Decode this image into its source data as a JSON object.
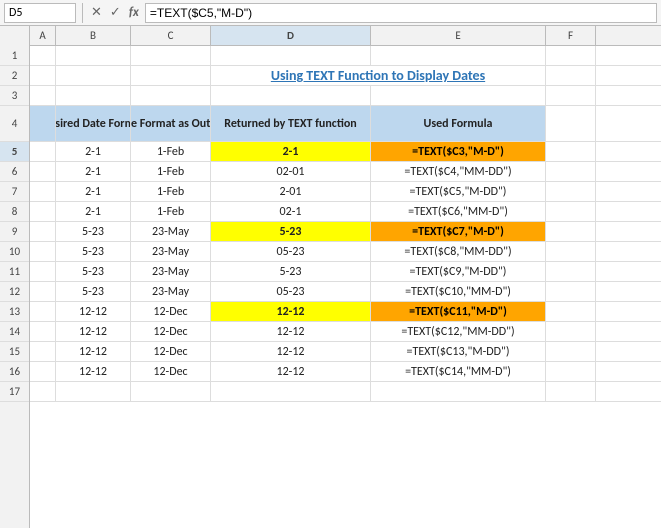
{
  "formulaBar": {
    "cellRef": "D5",
    "formula": "=TEXT($C5,\"M-D\")"
  },
  "title": "Using TEXT Function to Display Dates",
  "columns": {
    "A": {
      "label": "A",
      "class": "w-a"
    },
    "B": {
      "label": "B",
      "class": "w-b"
    },
    "C": {
      "label": "C",
      "class": "w-c"
    },
    "D": {
      "label": "D",
      "class": "w-d",
      "selected": true
    },
    "E": {
      "label": "E",
      "class": "w-e"
    },
    "F": {
      "label": "F",
      "class": "w-f"
    }
  },
  "headers": {
    "desiredDate": "Desired Date Format",
    "dateFormat": "Date Format as Output",
    "returned": "Returned by TEXT function",
    "usedFormula": "Used Formula"
  },
  "rows": [
    {
      "id": 1,
      "rowNum": "1",
      "a": "",
      "b": "",
      "c": "",
      "d": "",
      "e": "",
      "dClass": "",
      "eClass": ""
    },
    {
      "id": 2,
      "rowNum": "2",
      "a": "",
      "b": "",
      "c": "",
      "d": "Using TEXT Function to Display Dates",
      "e": "",
      "dClass": "title-cell",
      "eClass": "",
      "colspan": true
    },
    {
      "id": 3,
      "rowNum": "3",
      "a": "",
      "b": "",
      "c": "",
      "d": "",
      "e": "",
      "dClass": "",
      "eClass": ""
    },
    {
      "id": 4,
      "rowNum": "4",
      "a": "",
      "b": "Desired Date Format",
      "c": "Date Format as Output",
      "d": "Returned by TEXT function",
      "e": "Used Formula",
      "dClass": "header-bg",
      "eClass": "header-bg",
      "bClass": "header-bg",
      "cClass": "header-bg",
      "isHeader": true
    },
    {
      "id": 5,
      "rowNum": "5",
      "a": "",
      "b": "2-1",
      "c": "1-Feb",
      "d": "2-1",
      "e": "=TEXT($C3,\"M-D\")",
      "dClass": "yellow-bg",
      "eClass": "orange-bg"
    },
    {
      "id": 6,
      "rowNum": "6",
      "a": "",
      "b": "2-1",
      "c": "1-Feb",
      "d": "02-01",
      "e": "=TEXT($C4,\"MM-DD\")",
      "dClass": "",
      "eClass": ""
    },
    {
      "id": 7,
      "rowNum": "7",
      "a": "",
      "b": "2-1",
      "c": "1-Feb",
      "d": "2-01",
      "e": "=TEXT($C5,\"M-DD\")",
      "dClass": "",
      "eClass": ""
    },
    {
      "id": 8,
      "rowNum": "8",
      "a": "",
      "b": "2-1",
      "c": "1-Feb",
      "d": "02-1",
      "e": "=TEXT($C6,\"MM-D\")",
      "dClass": "",
      "eClass": ""
    },
    {
      "id": 9,
      "rowNum": "9",
      "a": "",
      "b": "5-23",
      "c": "23-May",
      "d": "5-23",
      "e": "=TEXT($C7,\"M-D\")",
      "dClass": "yellow-bg",
      "eClass": "orange-bg"
    },
    {
      "id": 10,
      "rowNum": "10",
      "a": "",
      "b": "5-23",
      "c": "23-May",
      "d": "05-23",
      "e": "=TEXT($C8,\"MM-DD\")",
      "dClass": "",
      "eClass": ""
    },
    {
      "id": 11,
      "rowNum": "11",
      "a": "",
      "b": "5-23",
      "c": "23-May",
      "d": "5-23",
      "e": "=TEXT($C9,\"M-DD\")",
      "dClass": "",
      "eClass": ""
    },
    {
      "id": 12,
      "rowNum": "12",
      "a": "",
      "b": "5-23",
      "c": "23-May",
      "d": "05-23",
      "e": "=TEXT($C10,\"MM-D\")",
      "dClass": "",
      "eClass": ""
    },
    {
      "id": 13,
      "rowNum": "13",
      "a": "",
      "b": "12-12",
      "c": "12-Dec",
      "d": "12-12",
      "e": "=TEXT($C11,\"M-D\")",
      "dClass": "yellow-bg",
      "eClass": "orange-bg"
    },
    {
      "id": 14,
      "rowNum": "14",
      "a": "",
      "b": "12-12",
      "c": "12-Dec",
      "d": "12-12",
      "e": "=TEXT($C12,\"MM-DD\")",
      "dClass": "",
      "eClass": ""
    },
    {
      "id": 15,
      "rowNum": "15",
      "a": "",
      "b": "12-12",
      "c": "12-Dec",
      "d": "12-12",
      "e": "=TEXT($C13,\"M-DD\")",
      "dClass": "",
      "eClass": ""
    },
    {
      "id": 16,
      "rowNum": "16",
      "a": "",
      "b": "12-12",
      "c": "12-Dec",
      "d": "12-12",
      "e": "=TEXT($C14,\"MM-D\")",
      "dClass": "",
      "eClass": ""
    },
    {
      "id": 17,
      "rowNum": "17",
      "a": "",
      "b": "",
      "c": "",
      "d": "",
      "e": "",
      "dClass": "",
      "eClass": ""
    }
  ]
}
